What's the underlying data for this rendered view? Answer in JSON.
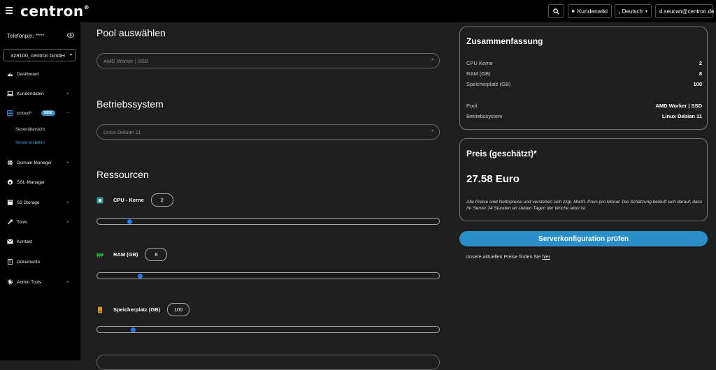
{
  "header": {
    "brand": "centron",
    "brand_mark": "®",
    "wiki_label": "Kundenwiki",
    "language": "Deutsch",
    "user_email": "d.seucan@centron.de",
    "caret": "▾"
  },
  "sidebar": {
    "pin_label": "Telefonpin: ****",
    "account": "328100, centron GmbH",
    "items": [
      {
        "label": "Dashboard",
        "icon": "dashboard-icon"
      },
      {
        "label": "Kundendaten",
        "icon": "laptop-icon",
        "plus": "+"
      },
      {
        "label": "ccloud³",
        "icon": "cloud-icon",
        "badge": "NEW",
        "plus": "−"
      },
      {
        "label": "Domain-Manager",
        "icon": "globe-icon",
        "plus": "+"
      },
      {
        "label": "SSL-Manager",
        "icon": "lock-icon"
      },
      {
        "label": "S3 Storage",
        "icon": "storage-icon",
        "plus": "+"
      },
      {
        "label": "Tools",
        "icon": "wrench-icon",
        "plus": "+"
      },
      {
        "label": "Kontakt",
        "icon": "envelope-icon"
      },
      {
        "label": "Dokumente",
        "icon": "document-icon"
      },
      {
        "label": "Admin Tools",
        "icon": "gear-icon",
        "plus": "+"
      }
    ],
    "subitems": [
      {
        "label": "Serverübersicht",
        "active": false
      },
      {
        "label": "Server erstellen",
        "active": true
      }
    ]
  },
  "main": {
    "pool_heading": "Pool auswählen",
    "pool_value": "AMD Worker | SSD",
    "os_heading": "Betriebssystem",
    "os_value": "Linux Debian 11",
    "resources_heading": "Ressourcen",
    "cpu": {
      "label": "CPU - Kerne",
      "value": "2",
      "slider_fraction": 0.09
    },
    "ram": {
      "label": "RAM (GB)",
      "value": "8",
      "slider_fraction": 0.12
    },
    "storage": {
      "label": "Speicherplatz (GB)",
      "value": "100",
      "slider_fraction": 0.1
    }
  },
  "summary": {
    "title": "Zusammenfassung",
    "rows": [
      {
        "k": "CPU Kerne",
        "v": "2"
      },
      {
        "k": "RAM (GB)",
        "v": "8"
      },
      {
        "k": "Speicherplatz (GB)",
        "v": "100"
      },
      {
        "k": "Pool",
        "v": "AMD Worker | SSD"
      },
      {
        "k": "Betriebssystem",
        "v": "Linux Debian 11"
      }
    ]
  },
  "price": {
    "title": "Preis (geschätzt)*",
    "value": "27.58 Euro",
    "note": "Alle Preise sind Nettopreise und verstehen sich zzgl. MwSt. Preis pro Monat. Die Schätzung beläuft sich darauf, dass Ihr Server 24 Stunden an sieben Tagen der Woche aktiv ist."
  },
  "cta_label": "Serverkonfiguration prüfen",
  "footnote": {
    "text": "Unsere aktuellen Preise finden Sie ",
    "link": "hier"
  },
  "colors": {
    "accent": "#2a8fc9",
    "slider_thumb": "#1f7bf2",
    "badge": "#3b8fd0"
  }
}
